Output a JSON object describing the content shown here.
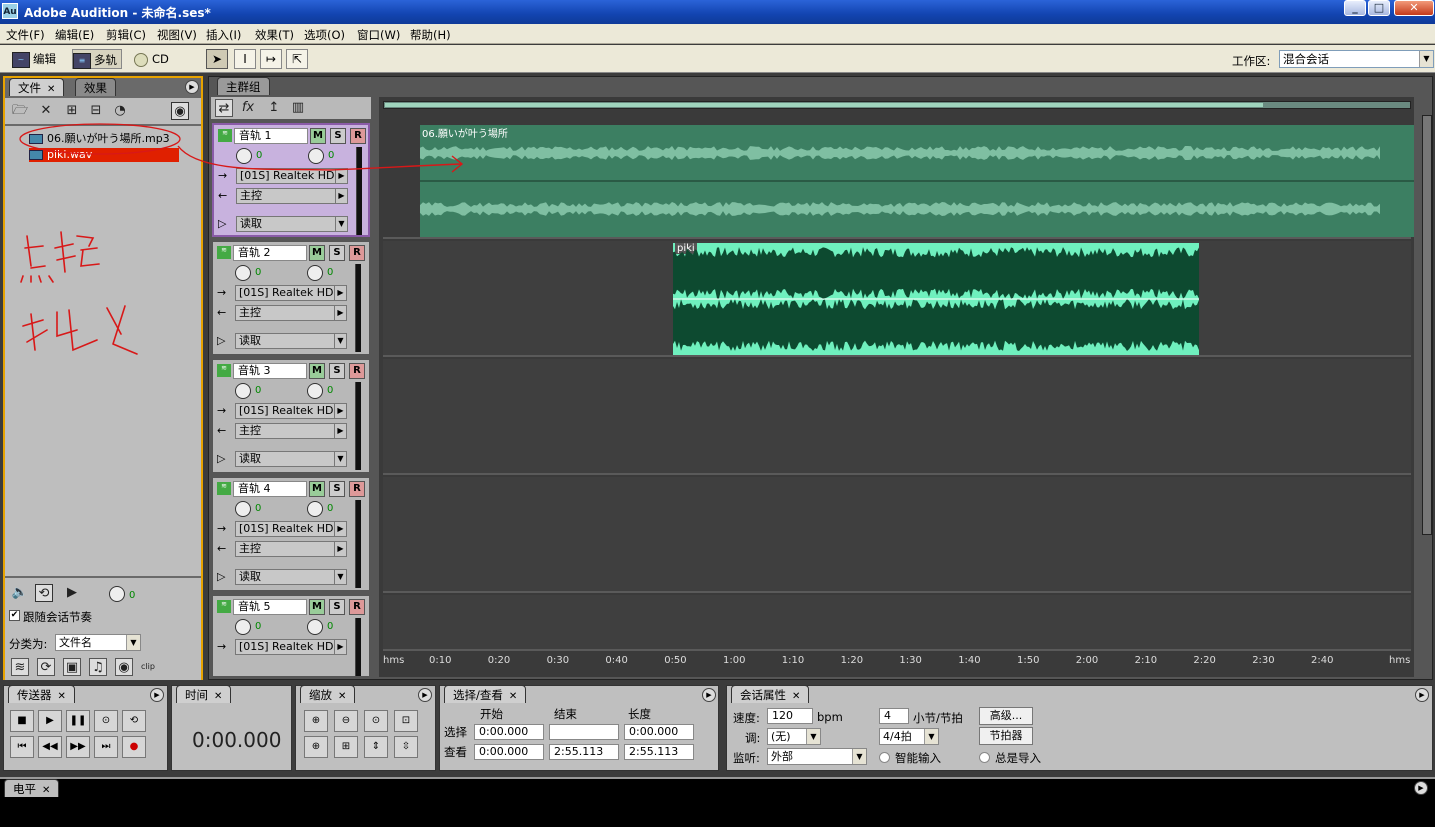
{
  "window": {
    "app_icon": "Au",
    "title": "Adobe Audition - 未命名.ses*"
  },
  "menu": [
    "文件(F)",
    "编辑(E)",
    "剪辑(C)",
    "视图(V)",
    "插入(I)",
    "效果(T)",
    "选项(O)",
    "窗口(W)",
    "帮助(H)"
  ],
  "toolbar": {
    "edit_label": "编辑",
    "multitrack_label": "多轨",
    "cd_label": "CD",
    "workspace_label": "工作区:",
    "workspace_value": "混合会话"
  },
  "files_panel": {
    "tabs": [
      "文件",
      "效果"
    ],
    "files": [
      "06.願いが叶う場所.mp3",
      "piki.wav"
    ],
    "follow_label": "跟随会话节奏",
    "sort_label": "分类为:",
    "sort_value": "文件名",
    "volume_value": "0"
  },
  "annotation": {
    "handwriting": "点击 拖入"
  },
  "main_panel": {
    "tab": "主群组"
  },
  "tracks": [
    {
      "name": "音轨 1",
      "vol": "0",
      "pan": "0",
      "output": "[01S] Realtek HD",
      "bus": "主控",
      "automation": "读取"
    },
    {
      "name": "音轨 2",
      "vol": "0",
      "pan": "0",
      "output": "[01S] Realtek HD",
      "bus": "主控",
      "automation": "读取"
    },
    {
      "name": "音轨 3",
      "vol": "0",
      "pan": "0",
      "output": "[01S] Realtek HD",
      "bus": "主控",
      "automation": "读取"
    },
    {
      "name": "音轨 4",
      "vol": "0",
      "pan": "0",
      "output": "[01S] Realtek HD",
      "bus": "主控",
      "automation": "读取"
    },
    {
      "name": "音轨 5",
      "vol": "0",
      "pan": "0",
      "output": "[01S] Realtek HD",
      "bus": "",
      "automation": ""
    }
  ],
  "clips": {
    "clip1_name": "06.願いが叶う場所",
    "clip2_name": "piki"
  },
  "ruler": [
    "hms",
    "0:10",
    "0:20",
    "0:30",
    "0:40",
    "0:50",
    "1:00",
    "1:10",
    "1:20",
    "1:30",
    "1:40",
    "1:50",
    "2:00",
    "2:10",
    "2:20",
    "2:30",
    "2:40",
    "hms"
  ],
  "transport": {
    "tab": "传送器"
  },
  "time": {
    "tab": "时间",
    "value": "0:00.000"
  },
  "zoom": {
    "tab": "缩放"
  },
  "selection": {
    "tab": "选择/查看",
    "col_start": "开始",
    "col_end": "结束",
    "col_length": "长度",
    "row_select": "选择",
    "row_view": "查看",
    "sel_start": "0:00.000",
    "sel_end": "",
    "sel_length": "0:00.000",
    "view_start": "0:00.000",
    "view_end": "2:55.113",
    "view_length": "2:55.113"
  },
  "session": {
    "tab": "会话属性",
    "tempo_label": "速度:",
    "tempo_value": "120",
    "bpm": "bpm",
    "beats_value": "4",
    "beats_label": "小节/节拍",
    "advanced": "高级...",
    "key_label": "调:",
    "key_value": "(无)",
    "sig_value": "4/4拍",
    "metronome": "节拍器",
    "monitor_label": "监听:",
    "monitor_value": "外部",
    "smart_input": "智能输入",
    "always_import": "总是导入"
  },
  "levels": {
    "tab": "电平"
  }
}
